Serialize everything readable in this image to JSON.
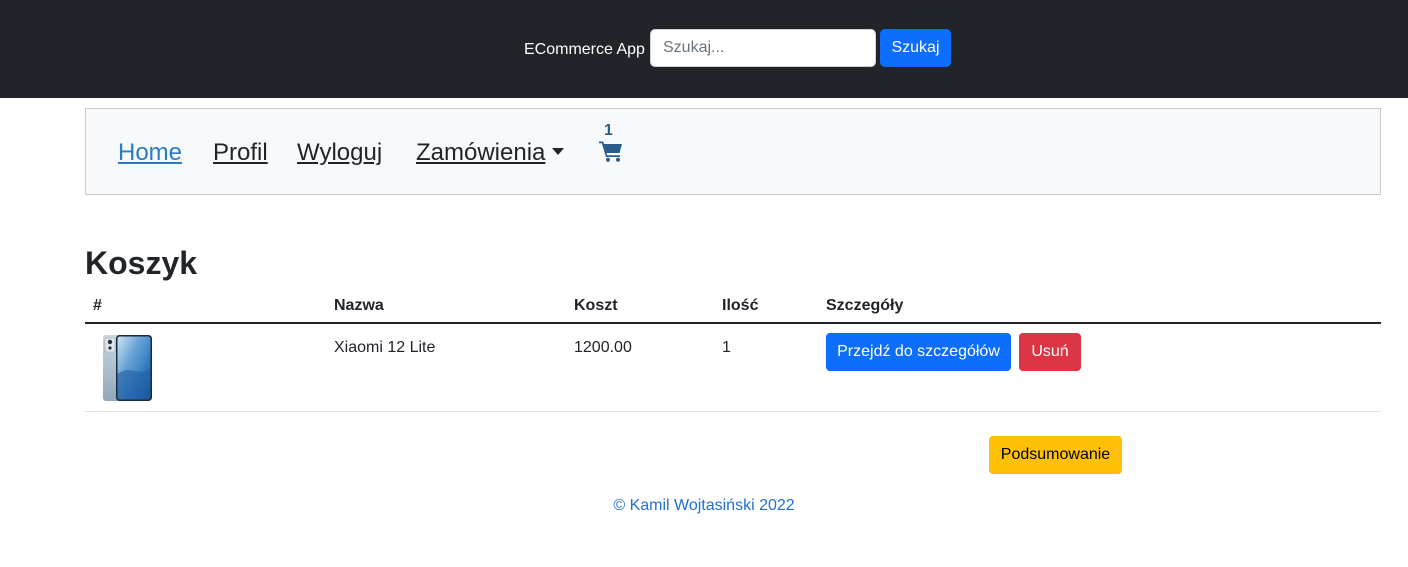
{
  "header": {
    "brand": "ECommerce App",
    "search_placeholder": "Szukaj...",
    "search_value": "",
    "search_button": "Szukaj"
  },
  "nav": {
    "home": "Home",
    "profile": "Profil",
    "logout": "Wyloguj",
    "orders": "Zamówienia",
    "cart_count": "1",
    "cart_icon": "shopping-cart-icon"
  },
  "page": {
    "title": "Koszyk"
  },
  "table": {
    "headers": [
      "#",
      "Nazwa",
      "Koszt",
      "Ilość",
      "Szczegóły"
    ],
    "rows": [
      {
        "image": "phone-product-image",
        "name": "Xiaomi 12 Lite",
        "cost": "1200.00",
        "quantity": "1",
        "details_button": "Przejdź do szczegółów",
        "remove_button": "Usuń"
      }
    ]
  },
  "summary_button": "Podsumowanie",
  "footer": {
    "text": "© Kamil Wojtasiński 2022"
  },
  "colors": {
    "topbar": "#212529",
    "primary": "#0d6efd",
    "danger": "#dc3545",
    "warning": "#ffc107",
    "footer_link": "#1f6fd4"
  }
}
